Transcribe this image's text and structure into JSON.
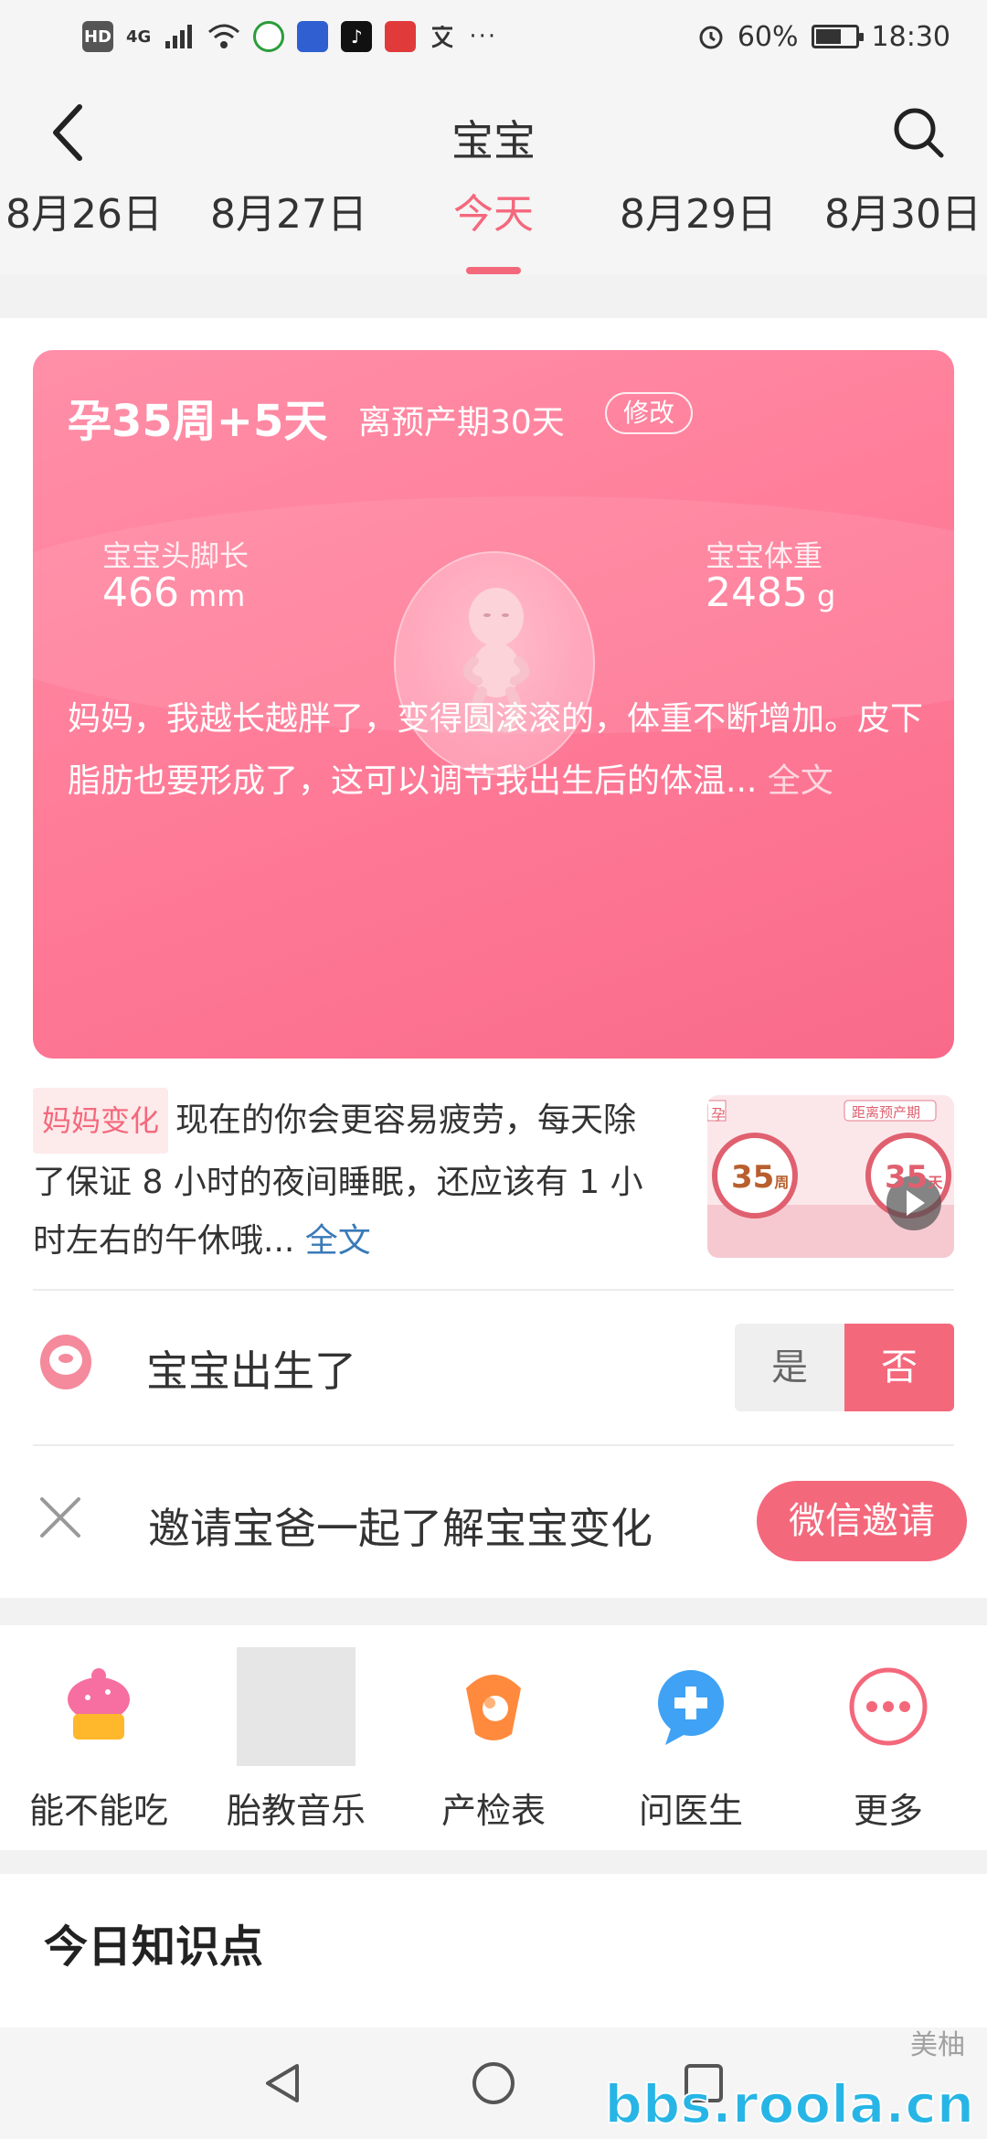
{
  "status_bar": {
    "left_labels": [
      "HD",
      "4G"
    ],
    "battery": "60%",
    "time": "18:30"
  },
  "header": {
    "title": "宝宝",
    "date_tabs": [
      "8月26日",
      "8月27日",
      "今天",
      "8月29日",
      "8月30日"
    ],
    "active_tab_index": 2
  },
  "card": {
    "week": "孕35周+5天",
    "due": "离预产期30天",
    "edit_label": "修改",
    "length_label": "宝宝头脚长",
    "length_value": "466",
    "length_unit": "mm",
    "weight_label": "宝宝体重",
    "weight_value": "2485",
    "weight_unit": "g",
    "description": "妈妈，我越长越胖了，变得圆滚滚的，体重不断增加。皮下脂肪也要形成了，这可以调节我出生后的体温...",
    "more_label": "全文"
  },
  "mom_change": {
    "tag": "妈妈变化",
    "text": "现在的你会更容易疲劳，每天除了保证 8 小时的夜间睡眠，还应该有 1 小时左右的午休哦...",
    "more_label": "全文",
    "video": {
      "left_ring_value": "35",
      "left_ring_unit": "周",
      "right_ring_value": "35",
      "right_ring_unit": "天",
      "right_tag": "距离预产期",
      "left_tag": "孕"
    }
  },
  "born": {
    "label": "宝宝出生了",
    "yes_label": "是",
    "no_label": "否"
  },
  "invite": {
    "label": "邀请宝爸一起了解宝宝变化",
    "button_label": "微信邀请"
  },
  "tools": [
    {
      "label": "能不能吃",
      "icon": "cupcake-icon"
    },
    {
      "label": "胎教音乐",
      "icon": "music-placeholder-icon"
    },
    {
      "label": "产检表",
      "icon": "ultrasound-icon"
    },
    {
      "label": "问医生",
      "icon": "doctor-chat-icon"
    },
    {
      "label": "更多",
      "icon": "more-dots-icon"
    }
  ],
  "knowledge": {
    "title": "今日知识点"
  },
  "watermark": {
    "site": "bbs.roola.cn",
    "brand": "美柚"
  },
  "colors": {
    "accent": "#f4687c",
    "card_gradient_start": "#ff8fa8",
    "card_gradient_end": "#f96a8a",
    "link": "#3a7ab8"
  }
}
